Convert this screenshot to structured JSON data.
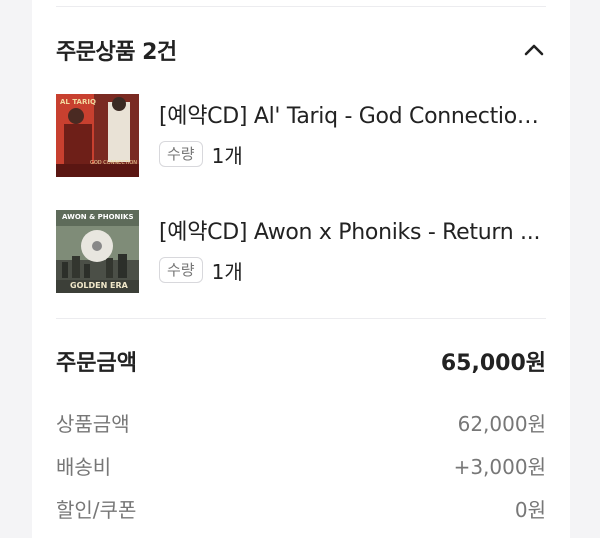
{
  "order_section": {
    "title": "주문상품 2건",
    "toggle_icon": "chevron-up-icon"
  },
  "products": [
    {
      "name": "[예약CD] Al' Tariq - God Connection...",
      "qty_label": "수량",
      "qty_value": "1개",
      "cover": {
        "logo_text": "AL TARIQ",
        "sub_text": "GOD CONNECTION"
      }
    },
    {
      "name": "[예약CD] Awon x Phoniks - Return ...",
      "qty_label": "수량",
      "qty_value": "1개",
      "cover": {
        "logo_text": "AWON & PHONIKS",
        "sub_text": "GOLDEN ERA"
      }
    }
  ],
  "summary": {
    "total_label": "주문금액",
    "total_value": "65,000원",
    "rows": [
      {
        "label": "상품금액",
        "value": "62,000원"
      },
      {
        "label": "배송비",
        "value": "+3,000원"
      },
      {
        "label": "할인/쿠폰",
        "value": "0원"
      }
    ]
  },
  "colors": {
    "background": "#f4f4f6",
    "card": "#ffffff",
    "text_primary": "#222222",
    "text_secondary": "#777777",
    "divider": "#ececef"
  }
}
